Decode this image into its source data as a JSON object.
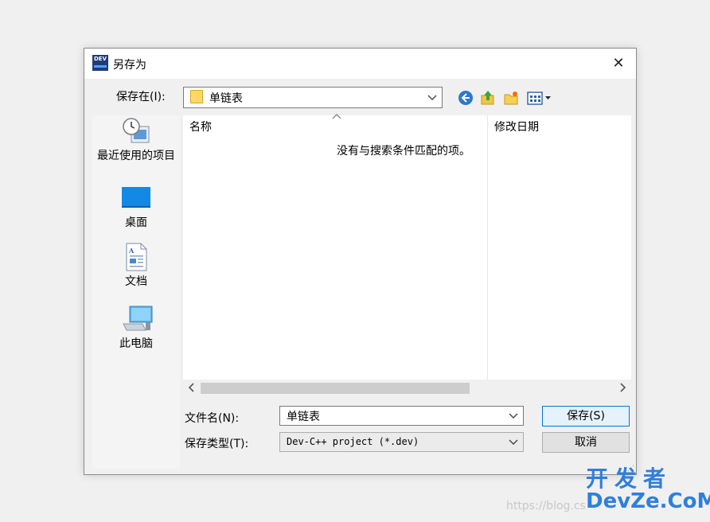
{
  "window": {
    "title": "另存为",
    "app_icon_text": "DEV",
    "close_symbol": "✕"
  },
  "toolbar": {
    "save_in_label": "保存在(I):",
    "location_value": "单链表",
    "icons": [
      "back-icon",
      "up-folder-icon",
      "new-folder-icon",
      "view-menu-icon"
    ]
  },
  "sidebar": {
    "items": [
      {
        "label": "最近使用的项目",
        "icon": "recent-items-icon"
      },
      {
        "label": "桌面",
        "icon": "desktop-icon"
      },
      {
        "label": "文档",
        "icon": "documents-icon"
      },
      {
        "label": "此电脑",
        "icon": "this-pc-icon"
      }
    ]
  },
  "filelist": {
    "columns": [
      "名称",
      "修改日期"
    ],
    "sort_indicator": "^",
    "empty_message": "没有与搜索条件匹配的项。"
  },
  "form": {
    "filename_label": "文件名(N):",
    "filename_value": "单链表",
    "filetype_label": "保存类型(T):",
    "filetype_value": "Dev-C++ project (*.dev)"
  },
  "buttons": {
    "save": "保存(S)",
    "cancel": "取消"
  },
  "watermark": {
    "line1": "开发者",
    "line2": "DevZe.CoM",
    "url": "https://blog.cs"
  },
  "colors": {
    "accent": "#0078d7",
    "watermark": "#2f7fdb"
  }
}
